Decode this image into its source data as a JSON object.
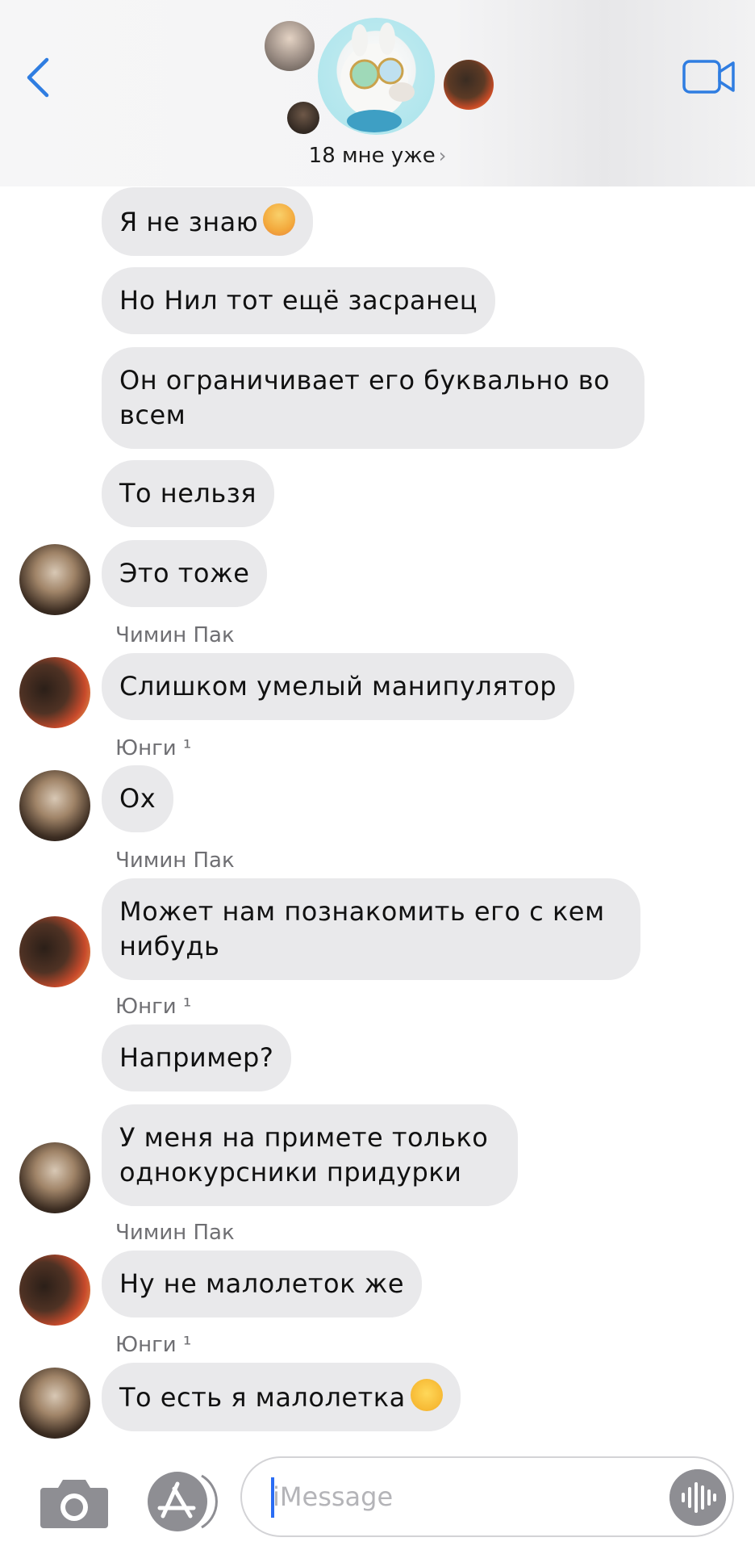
{
  "header": {
    "group_name": "18 мне уже",
    "chevron": "›",
    "back_icon": "chevron-left-icon",
    "video_icon": "video-camera-icon",
    "accent": "#2f7de1"
  },
  "messages": [
    {
      "text": "Я не знаю"
    },
    {
      "text": "Но Нил тот ещё засранец"
    },
    {
      "text": "Он ограничивает его буквально во всем"
    },
    {
      "text": "То нельзя"
    },
    {
      "text": "Это тоже"
    },
    {
      "sender": "Чимин Пак",
      "text": "Слишком умелый манипулятор"
    },
    {
      "sender": "Юнги ¹",
      "text": "Ох"
    },
    {
      "sender": "Чимин Пак",
      "text": "Может нам познакомить его с кем нибудь"
    },
    {
      "sender": "Юнги ¹",
      "text": "Например?"
    },
    {
      "text": "У меня на примете только однокурсники придурки"
    },
    {
      "sender": "Чимин Пак",
      "text": "Ну не малолеток же"
    },
    {
      "sender": "Юнги ¹",
      "text": "То есть я малолетка"
    }
  ],
  "composer": {
    "placeholder": "iMessage",
    "camera_icon": "camera-icon",
    "apps_icon": "app-store-icon",
    "audio_icon": "audio-waveform-icon"
  },
  "colors": {
    "bubble": "#e9e9eb",
    "accent": "#2f7de1"
  }
}
